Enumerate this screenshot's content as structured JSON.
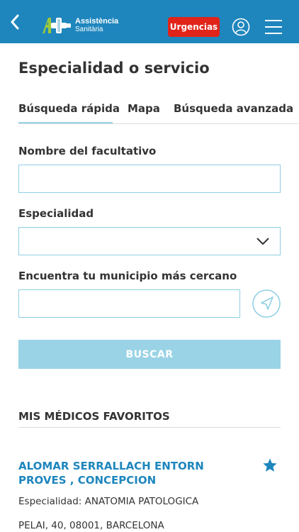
{
  "header": {
    "logo_line1": "Assistència",
    "logo_line2": "Sanitària",
    "urgencias_label": "Urgencias",
    "icons": [
      "chevron-left-icon",
      "cross-logo-icon",
      "user-icon",
      "hamburger-menu-icon"
    ],
    "colors": {
      "bar": "#1e86bd",
      "urgencias": "#e1241a"
    }
  },
  "page": {
    "title": "Especialidad o servicio"
  },
  "tabs": [
    {
      "label": "Búsqueda rápida",
      "active": true
    },
    {
      "label": "Mapa",
      "active": false
    },
    {
      "label": "Búsqueda avanzada",
      "active": false
    }
  ],
  "form": {
    "nombre_label": "Nombre del facultativo",
    "nombre_value": "",
    "especialidad_label": "Especialidad",
    "especialidad_value": "",
    "municipio_label": "Encuentra tu municipio más cercano",
    "municipio_value": "",
    "search_label": "BUSCAR"
  },
  "favorites": {
    "title": "MIS MÉDICOS FAVORITOS",
    "items": [
      {
        "name": "ALOMAR SERRALLACH ENTORN PROVES , CONCEPCION",
        "specialty": "Especialidad: ANATOMIA PATOLOGICA",
        "address": "PELAI, 40, 08001, BARCELONA",
        "favorite": true
      }
    ]
  },
  "colors": {
    "accent": "#1e86bd",
    "light_accent": "#9ad3e6",
    "text": "#333333"
  }
}
